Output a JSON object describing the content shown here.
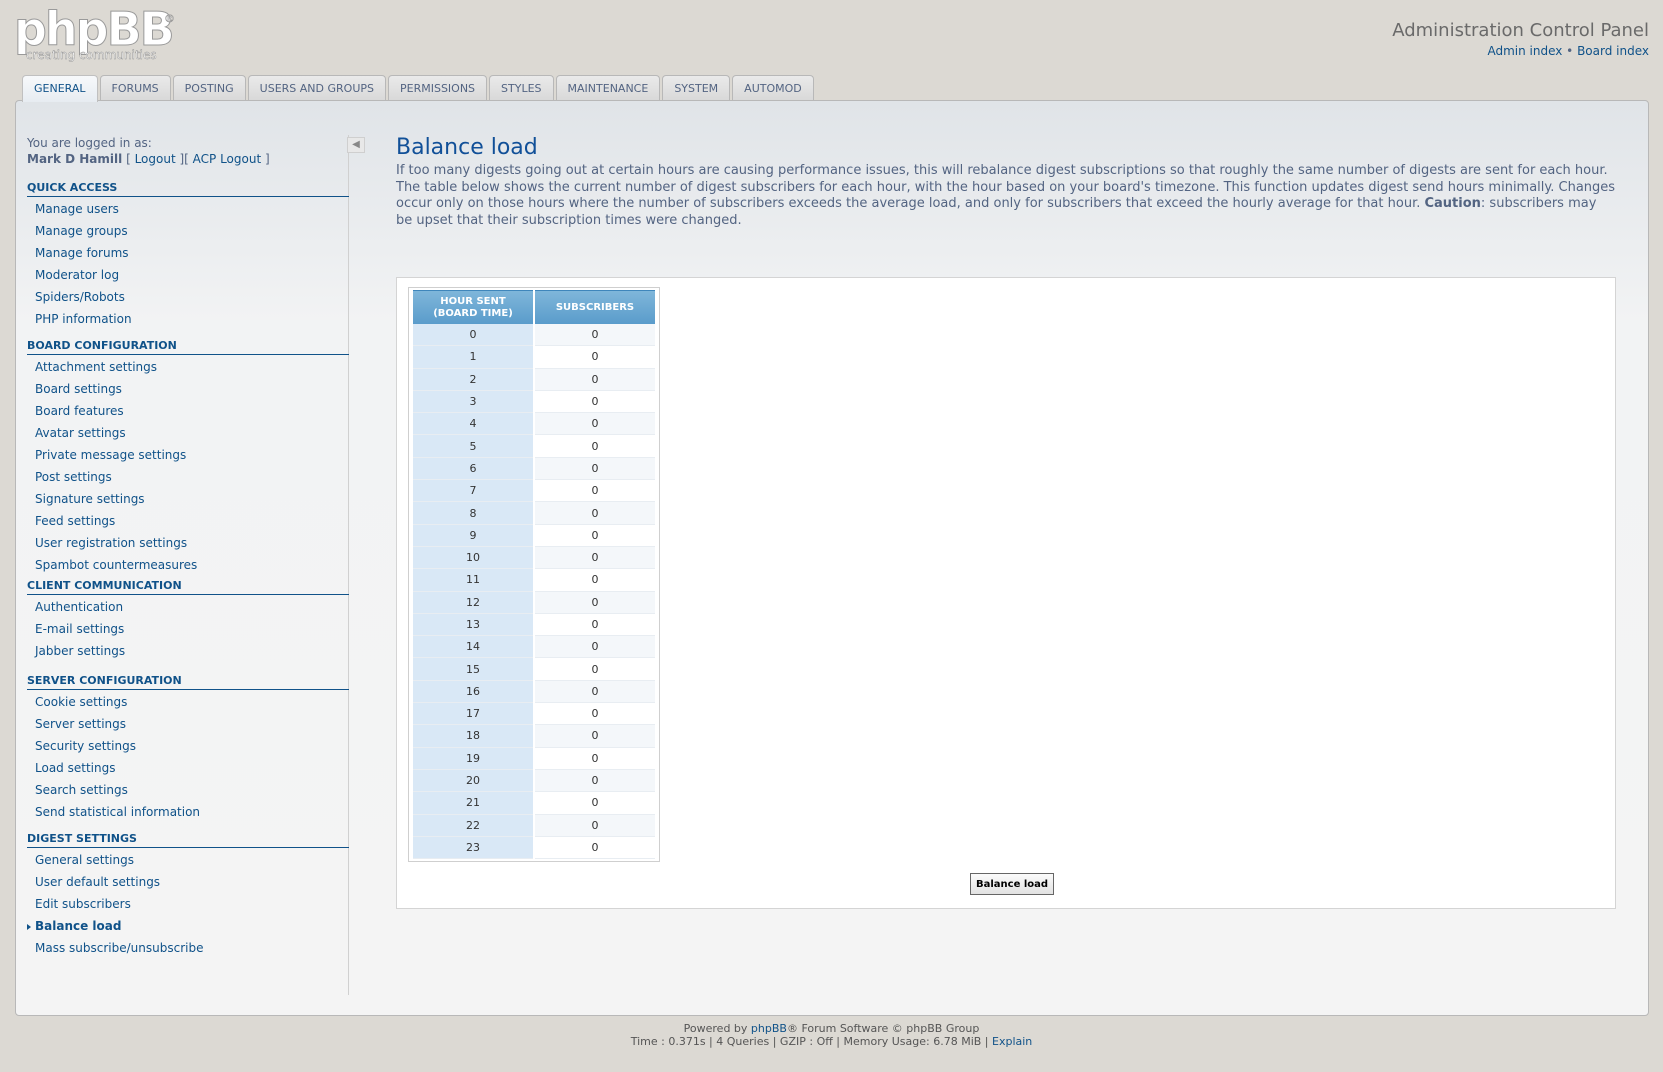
{
  "header": {
    "logo_word": "phpBB",
    "logo_tagline": "creating  communities",
    "logo_reg": "®",
    "title": "Administration Control Panel",
    "admin_index": "Admin index",
    "separator": "•",
    "board_index": "Board index"
  },
  "tabs": [
    {
      "label": "General",
      "active": true
    },
    {
      "label": "Forums"
    },
    {
      "label": "Posting"
    },
    {
      "label": "Users and Groups"
    },
    {
      "label": "Permissions"
    },
    {
      "label": "Styles"
    },
    {
      "label": "Maintenance"
    },
    {
      "label": "System"
    },
    {
      "label": "AutoMOD"
    }
  ],
  "sidebar": {
    "logged_in_label": "You are logged in as:",
    "username": "Mark D Hamill",
    "logout_open": " [ ",
    "logout": "Logout",
    "acp_logout_sep": " ][ ",
    "acp_logout": "ACP Logout",
    "logout_close": " ]",
    "collapse_glyph": "◀",
    "sections": [
      {
        "heading": "Quick Access",
        "items": [
          "Manage users",
          "Manage groups",
          "Manage forums",
          "Moderator log",
          "Spiders/Robots",
          "PHP information"
        ]
      },
      {
        "heading": "Board Configuration",
        "items": [
          "Attachment settings",
          "Board settings",
          "Board features",
          "Avatar settings",
          "Private message settings",
          "Post settings",
          "Signature settings",
          "Feed settings",
          "User registration settings",
          "Spambot countermeasures"
        ]
      },
      {
        "heading": "Client Communication",
        "items": [
          "Authentication",
          "E-mail settings",
          "Jabber settings"
        ]
      },
      {
        "heading": "Server Configuration",
        "items": [
          "Cookie settings",
          "Server settings",
          "Security settings",
          "Load settings",
          "Search settings",
          "Send statistical information"
        ]
      },
      {
        "heading": "Digest Settings",
        "items": [
          "General settings",
          "User default settings",
          "Edit subscribers",
          "Balance load",
          "Mass subscribe/unsubscribe"
        ]
      }
    ],
    "active_item": "Balance load"
  },
  "main": {
    "title": "Balance load",
    "description_main": "If too many digests going out at certain hours are causing performance issues, this will rebalance digest subscriptions so that roughly the same number of digests are sent for each hour. The table below shows the current number of digest subscribers for each hour, with the hour based on your board's timezone. This function updates digest send hours minimally. Changes occur only on those hours where the number of subscribers exceeds the average load, and only for subscribers that exceed the hourly average for that hour. ",
    "description_caution": "Caution",
    "description_tail": ": subscribers may be upset that their subscription times were changed.",
    "table": {
      "col1_line1": "Hour sent",
      "col1_line2": "(board time)",
      "col2": "Subscribers",
      "rows": [
        [
          "0",
          "0"
        ],
        [
          "1",
          "0"
        ],
        [
          "2",
          "0"
        ],
        [
          "3",
          "0"
        ],
        [
          "4",
          "0"
        ],
        [
          "5",
          "0"
        ],
        [
          "6",
          "0"
        ],
        [
          "7",
          "0"
        ],
        [
          "8",
          "0"
        ],
        [
          "9",
          "0"
        ],
        [
          "10",
          "0"
        ],
        [
          "11",
          "0"
        ],
        [
          "12",
          "0"
        ],
        [
          "13",
          "0"
        ],
        [
          "14",
          "0"
        ],
        [
          "15",
          "0"
        ],
        [
          "16",
          "0"
        ],
        [
          "17",
          "0"
        ],
        [
          "18",
          "0"
        ],
        [
          "19",
          "0"
        ],
        [
          "20",
          "0"
        ],
        [
          "21",
          "0"
        ],
        [
          "22",
          "0"
        ],
        [
          "23",
          "0"
        ]
      ]
    },
    "button_label": "Balance load"
  },
  "footer": {
    "powered_prefix": "Powered by ",
    "powered_link": "phpBB",
    "powered_suffix": "® Forum Software © phpBB Group",
    "stats": "Time : 0.371s | 4 Queries | GZIP : Off | Memory Usage: 6.78 MiB | ",
    "explain": "Explain"
  }
}
